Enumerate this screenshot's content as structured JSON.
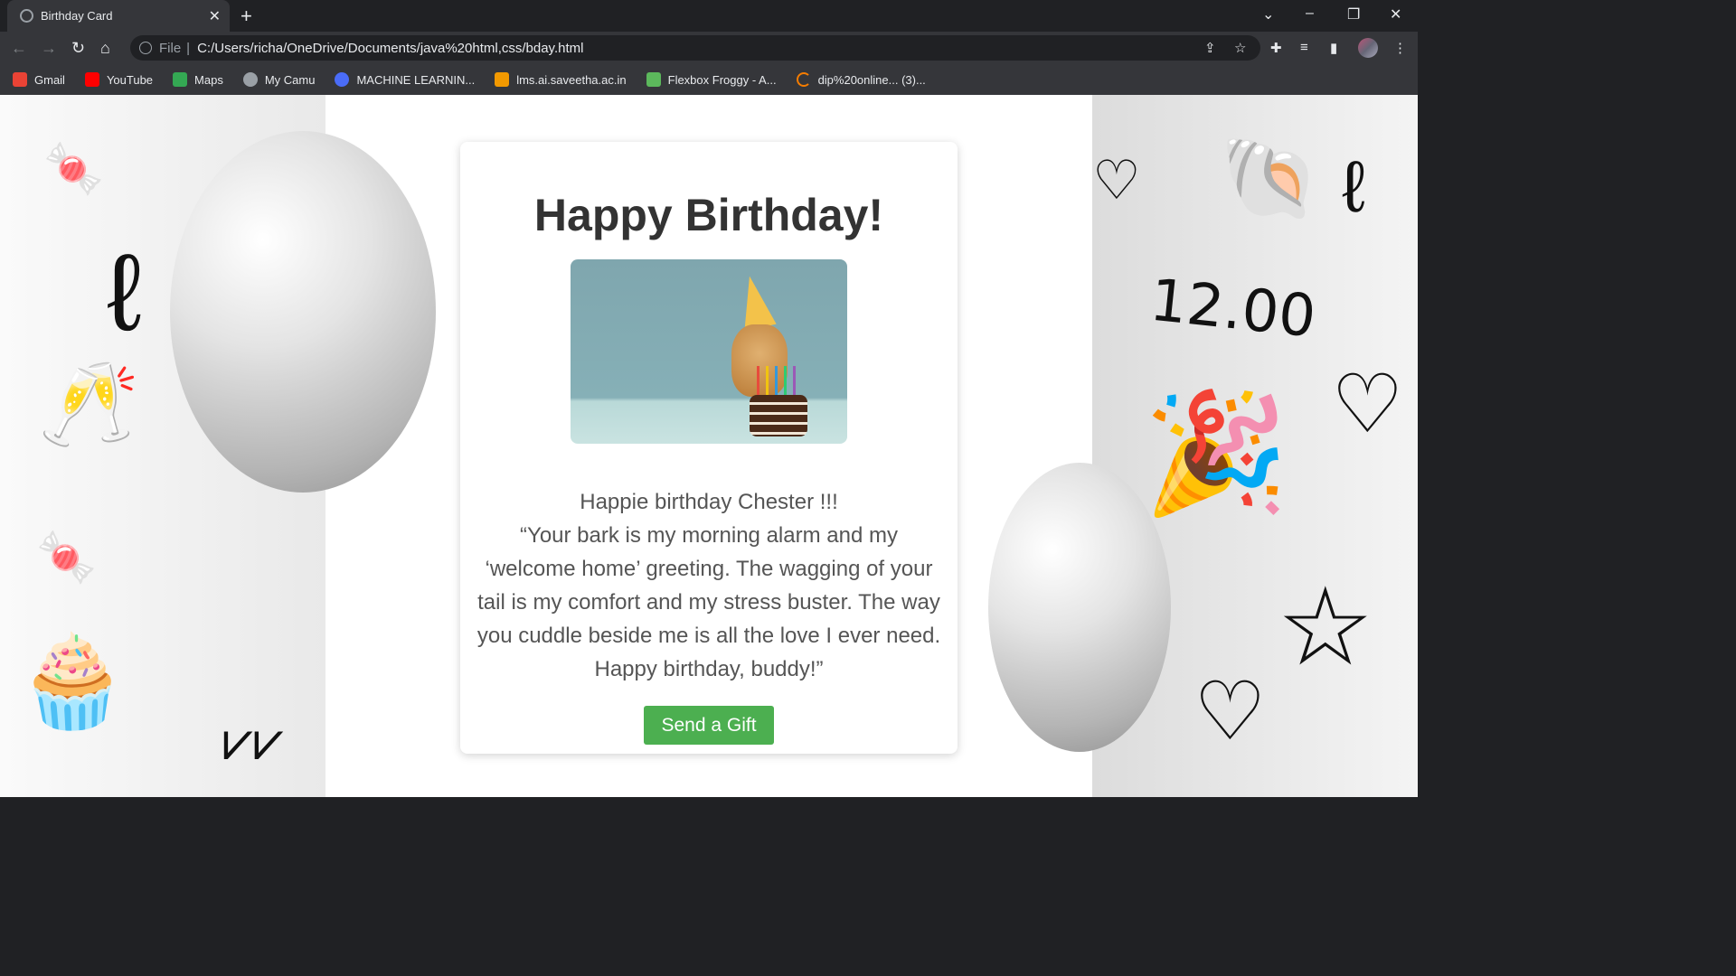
{
  "browser": {
    "tab_title": "Birthday Card",
    "address_prefix": "File",
    "url": "C:/Users/richa/OneDrive/Documents/java%20html,css/bday.html",
    "bookmarks": [
      {
        "label": "Gmail",
        "icon": "gmail-icon",
        "color": "#ea4335"
      },
      {
        "label": "YouTube",
        "icon": "youtube-icon",
        "color": "#ff0000"
      },
      {
        "label": "Maps",
        "icon": "maps-icon",
        "color": "#34a853"
      },
      {
        "label": "My Camu",
        "icon": "globe-icon",
        "color": "#9aa0a6"
      },
      {
        "label": "MACHINE LEARNIN...",
        "icon": "circle-icon",
        "color": "#4a6cf7"
      },
      {
        "label": "lms.ai.saveetha.ac.in",
        "icon": "lms-icon",
        "color": "#f29900"
      },
      {
        "label": "Flexbox Froggy - A...",
        "icon": "frog-icon",
        "color": "#5cb85c"
      },
      {
        "label": "dip%20online... (3)...",
        "icon": "loading-icon",
        "color": "#f57c00"
      }
    ]
  },
  "card": {
    "title": "Happy Birthday!",
    "greeting": "Happie birthday Chester !!!",
    "quote": "“Your bark is my morning alarm and my ‘welcome home’ greeting. The wagging of your tail is my comfort and my stress buster. The way you cuddle beside me is all the love I ever need. Happy birthday, buddy!”",
    "button_label": "Send a Gift",
    "button_color": "#4caf50"
  },
  "background": {
    "doodle_text": "12.00"
  }
}
